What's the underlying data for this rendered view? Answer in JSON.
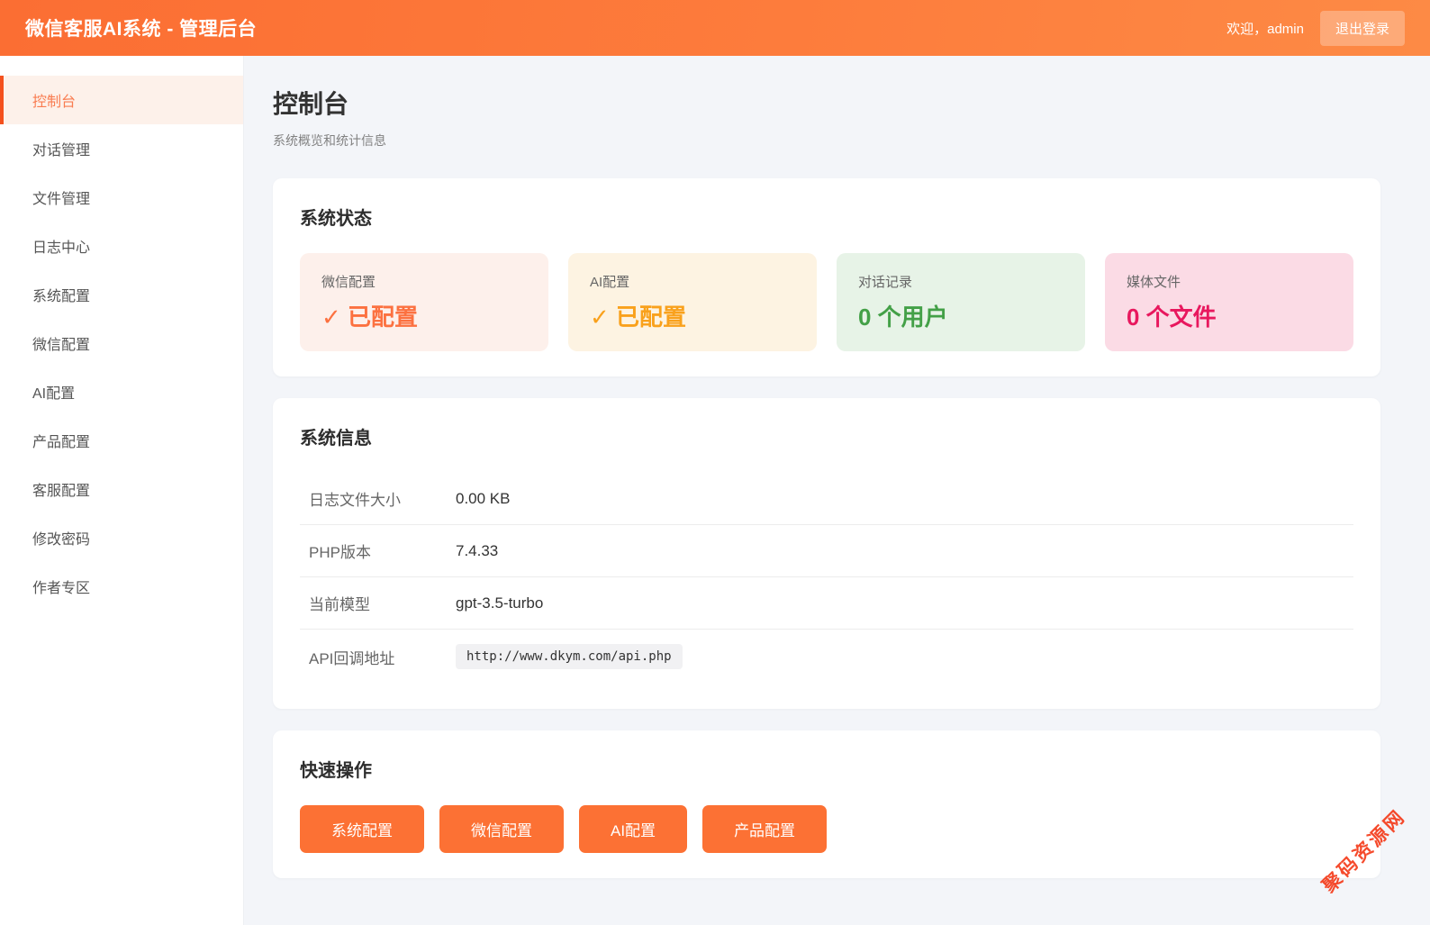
{
  "header": {
    "title": "微信客服AI系统 - 管理后台",
    "welcome": "欢迎，admin",
    "logout_label": "退出登录"
  },
  "sidebar": {
    "items": [
      {
        "label": "控制台",
        "active": true
      },
      {
        "label": "对话管理",
        "active": false
      },
      {
        "label": "文件管理",
        "active": false
      },
      {
        "label": "日志中心",
        "active": false
      },
      {
        "label": "系统配置",
        "active": false
      },
      {
        "label": "微信配置",
        "active": false
      },
      {
        "label": "AI配置",
        "active": false
      },
      {
        "label": "产品配置",
        "active": false
      },
      {
        "label": "客服配置",
        "active": false
      },
      {
        "label": "修改密码",
        "active": false
      },
      {
        "label": "作者专区",
        "active": false
      }
    ]
  },
  "page": {
    "title": "控制台",
    "subtitle": "系统概览和统计信息"
  },
  "system_status": {
    "heading": "系统状态",
    "cards": [
      {
        "label": "微信配置",
        "value": "✓ 已配置",
        "bg": "#fdf0eb",
        "fg": "#fc7140"
      },
      {
        "label": "AI配置",
        "value": "✓ 已配置",
        "bg": "#fdf3e2",
        "fg": "#f9a11c"
      },
      {
        "label": "对话记录",
        "value": "0 个用户",
        "bg": "#e7f3e7",
        "fg": "#43a047"
      },
      {
        "label": "媒体文件",
        "value": "0 个文件",
        "bg": "#fbdbe5",
        "fg": "#e8185e"
      }
    ]
  },
  "system_info": {
    "heading": "系统信息",
    "rows": [
      {
        "label": "日志文件大小",
        "value": "0.00 KB",
        "code": false
      },
      {
        "label": "PHP版本",
        "value": "7.4.33",
        "code": false
      },
      {
        "label": "当前模型",
        "value": "gpt-3.5-turbo",
        "code": false
      },
      {
        "label": "API回调地址",
        "value": "http://www.dkym.com/api.php",
        "code": true
      }
    ]
  },
  "quick_actions": {
    "heading": "快速操作",
    "buttons": [
      {
        "label": "系统配置"
      },
      {
        "label": "微信配置"
      },
      {
        "label": "AI配置"
      },
      {
        "label": "产品配置"
      }
    ]
  },
  "watermark": {
    "text": "聚码资源网",
    "color": "#f53b1a"
  },
  "colors": {
    "accent": "#fc7134",
    "header_gradient_start": "#fb6e33",
    "header_gradient_end": "#fd8a45",
    "active_item_bg": "#fdf1ea",
    "active_item_border": "#f4511e"
  }
}
